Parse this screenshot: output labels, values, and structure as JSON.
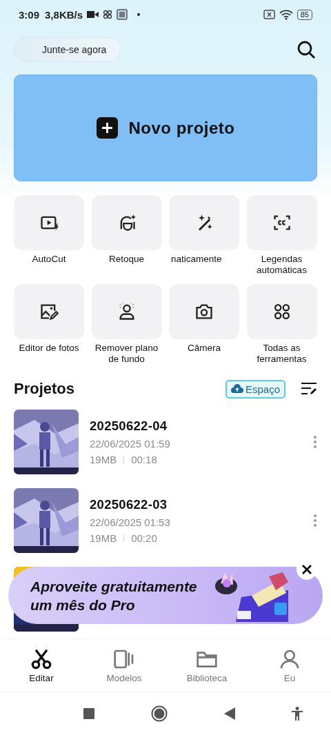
{
  "status_bar": {
    "time": "3:09",
    "speed": "3,8KB/s",
    "battery": "85"
  },
  "header": {
    "join_button": "Junte-se agora"
  },
  "new_project": {
    "label": "Novo projeto"
  },
  "tools": [
    {
      "label": "AutoCut",
      "kind": "autocut"
    },
    {
      "label": "Retoque",
      "kind": "retouch"
    },
    {
      "label": "naticamente",
      "kind": "wand"
    },
    {
      "label": "Legendas automáticas",
      "kind": "cc"
    },
    {
      "label": "Editor de fotos"
    },
    {
      "label": "Remover plano de fundo",
      "kind": "person"
    },
    {
      "label": "Câmera",
      "kind": "camera"
    },
    {
      "label": "Todas as ferramentas",
      "kind": "grid"
    }
  ],
  "projects": {
    "title": "Projetos",
    "space_button": "Espaço",
    "items": [
      {
        "name": "20250622-04",
        "date": "22/06/2025 01:59",
        "size": "19MB",
        "duration": "00:18"
      },
      {
        "name": "20250622-03",
        "date": "22/06/2025 01:53",
        "size": "19MB",
        "duration": "00:20"
      }
    ]
  },
  "promo": {
    "lines": [
      "Aproveite gratuitamente",
      "um mês do Pro"
    ]
  },
  "bottom_nav": [
    {
      "label": "Editar",
      "kind": "scissors",
      "selected": true
    },
    {
      "label": "Modelos",
      "kind": "templates",
      "selected": false
    },
    {
      "label": "Biblioteca",
      "kind": "folder",
      "selected": false
    },
    {
      "label": "Eu",
      "kind": "user",
      "selected": false
    }
  ]
}
